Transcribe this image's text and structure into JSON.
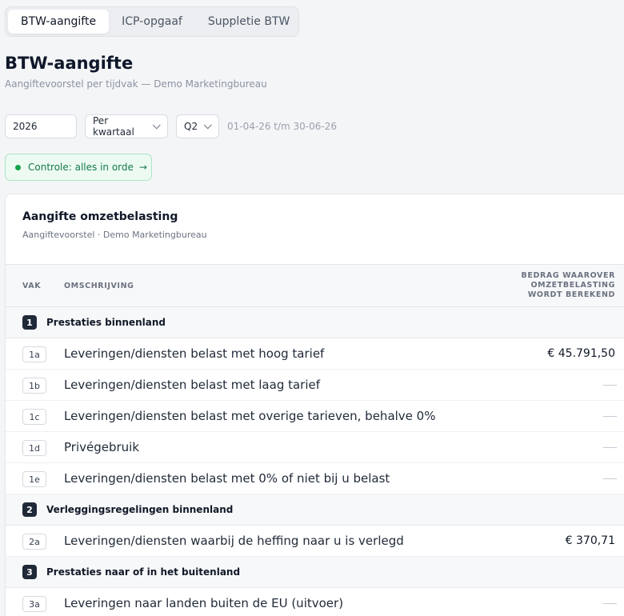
{
  "tabs": [
    {
      "label": "BTW-aangifte",
      "active": true
    },
    {
      "label": "ICP-opgaaf",
      "active": false
    },
    {
      "label": "Suppletie BTW",
      "active": false
    }
  ],
  "header": {
    "title": "BTW-aangifte",
    "subtitle": "Aangiftevoorstel per tijdvak — Demo Marketingbureau"
  },
  "filters": {
    "year": "2026",
    "period": "Per kwartaal",
    "quarter": "Q2",
    "range": "01-04-26 t/m 30-06-26"
  },
  "status": {
    "label": "Controle: alles in orde",
    "arrow": "→",
    "color": "#16a34a"
  },
  "card": {
    "title": "Aangifte omzetbelasting",
    "subtitle": "Aangiftevoorstel · Demo Marketingbureau",
    "columns": {
      "vak": "VAK",
      "omschrijving": "OMSCHRIJVING",
      "bedrag": "BEDRAG WAAROVER OMZETBELASTING WORDT BEREKEND"
    },
    "sections": [
      {
        "num": "1",
        "label": "Prestaties binnenland",
        "rows": [
          {
            "code": "1a",
            "desc": "Leveringen/diensten belast met hoog tarief",
            "amount": "€ 45.791,50"
          },
          {
            "code": "1b",
            "desc": "Leveringen/diensten belast met laag tarief",
            "amount": ""
          },
          {
            "code": "1c",
            "desc": "Leveringen/diensten belast met overige tarieven, behalve 0%",
            "amount": ""
          },
          {
            "code": "1d",
            "desc": "Privégebruik",
            "amount": ""
          },
          {
            "code": "1e",
            "desc": "Leveringen/diensten belast met 0% of niet bij u belast",
            "amount": ""
          }
        ]
      },
      {
        "num": "2",
        "label": "Verleggingsregelingen binnenland",
        "rows": [
          {
            "code": "2a",
            "desc": "Leveringen/diensten waarbij de heffing naar u is verlegd",
            "amount": "€ 370,71"
          }
        ]
      },
      {
        "num": "3",
        "label": "Prestaties naar of in het buitenland",
        "rows": [
          {
            "code": "3a",
            "desc": "Leveringen naar landen buiten de EU (uitvoer)",
            "amount": ""
          }
        ]
      }
    ]
  }
}
